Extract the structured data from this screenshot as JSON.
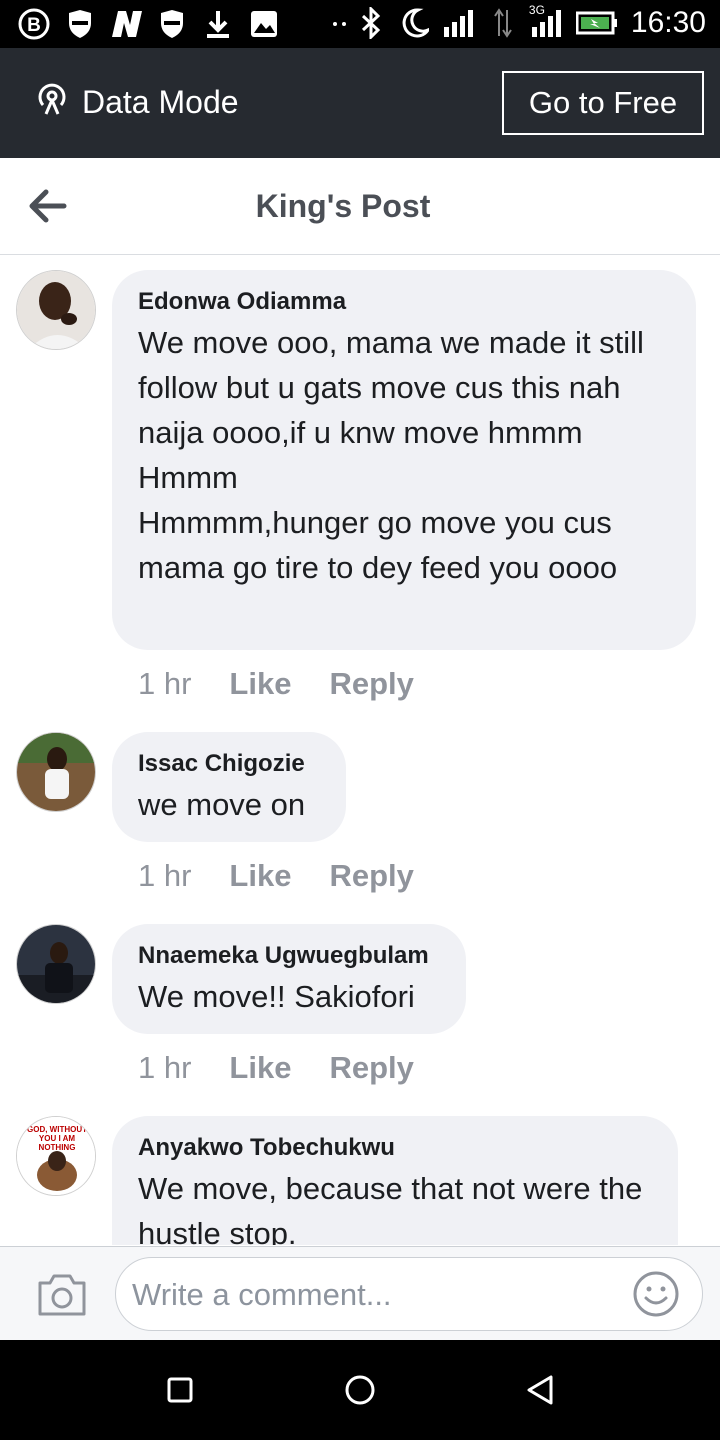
{
  "status_bar": {
    "time": "16:30",
    "network": "3G",
    "icons": [
      "b-icon",
      "shield-icon",
      "n-icon",
      "shield-icon",
      "download-icon",
      "image-icon",
      "more-dots-icon",
      "bluetooth-icon",
      "moon-icon",
      "signal-icon",
      "data-arrows-icon",
      "signal-3g-icon",
      "battery-charging-icon"
    ]
  },
  "data_bar": {
    "mode_label": "Data Mode",
    "go_free_label": "Go to Free"
  },
  "header": {
    "title": "King's Post"
  },
  "comments": [
    {
      "author": "Edonwa Odiamma",
      "text": "We move ooo, mama we made it still follow but u gats move cus this nah naija oooo,if u knw move hmmm\nHmmm\nHmmmm,hunger go move you cus mama go tire to dey feed you oooo",
      "time": "1 hr",
      "like": "Like",
      "reply": "Reply"
    },
    {
      "author": "Issac Chigozie",
      "text": "we move on",
      "time": "1 hr",
      "like": "Like",
      "reply": "Reply"
    },
    {
      "author": "Nnaemeka Ugwuegbulam",
      "text": "We move!! Sakiofori",
      "time": "1 hr",
      "like": "Like",
      "reply": "Reply"
    },
    {
      "author": "Anyakwo Tobechukwu",
      "text": "We move, because that not were the hustle stop.",
      "avatar_caption": "GOD, WITHOUT YOU I AM NOTHING"
    }
  ],
  "composer": {
    "placeholder": "Write a comment..."
  },
  "colors": {
    "data_bar_bg": "#262a30",
    "bubble_bg": "#f0f1f5",
    "meta_text": "#90949c"
  }
}
